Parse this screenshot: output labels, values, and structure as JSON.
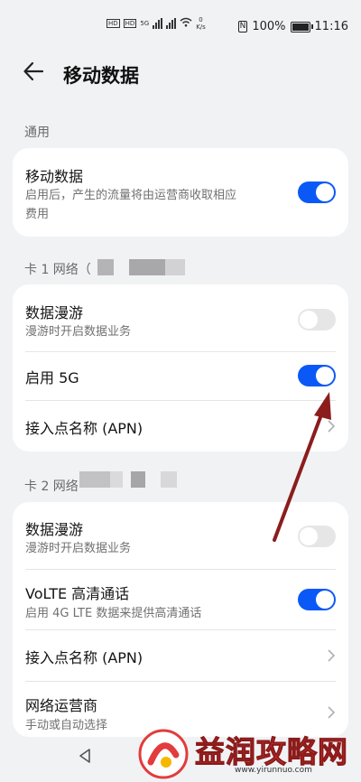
{
  "status_bar": {
    "left_badges": [
      "HD",
      "HD",
      "5G"
    ],
    "speed_value": "0",
    "speed_unit": "K/s",
    "battery": "100%",
    "time": "11:16"
  },
  "header": {
    "title": "移动数据"
  },
  "sections": {
    "general": "通用",
    "card1": "卡 1 网络（",
    "card2": "卡 2 网络"
  },
  "general": {
    "mobile_data": {
      "title": "移动数据",
      "desc_line1": "启用后，产生的流量将由运营商收取相应",
      "desc_line2": "费用",
      "on": true
    }
  },
  "card1": {
    "roaming": {
      "title": "数据漫游",
      "desc": "漫游时开启数据业务",
      "on": false
    },
    "enable_5g": {
      "title": "启用 5G",
      "on": true
    },
    "apn": {
      "title": "接入点名称 (APN)"
    }
  },
  "card2": {
    "roaming": {
      "title": "数据漫游",
      "desc": "漫游时开启数据业务",
      "on": false
    },
    "volte": {
      "title": "VoLTE 高清通话",
      "desc": "启用 4G LTE 数据来提供高清通话",
      "on": true
    },
    "apn": {
      "title": "接入点名称 (APN)"
    },
    "carrier": {
      "title": "网络运营商",
      "desc": "手动或自动选择"
    }
  },
  "watermark": {
    "brand": "益润攻略网",
    "url": "www.yirunnuo.com"
  },
  "colors": {
    "accent": "#0a59f7",
    "toggle_off": "#e6e6e6",
    "background": "#f1f2f4",
    "annotation_arrow": "#8b1d1d"
  }
}
